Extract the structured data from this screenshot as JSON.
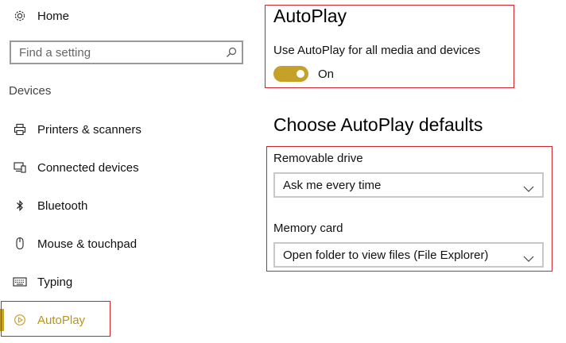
{
  "nav": {
    "home_label": "Home",
    "search_placeholder": "Find a setting",
    "section_title": "Devices",
    "items": [
      {
        "label": "Printers & scanners",
        "icon": "printer-icon",
        "selected": false
      },
      {
        "label": "Connected devices",
        "icon": "connected-devices-icon",
        "selected": false
      },
      {
        "label": "Bluetooth",
        "icon": "bluetooth-icon",
        "selected": false
      },
      {
        "label": "Mouse & touchpad",
        "icon": "mouse-icon",
        "selected": false
      },
      {
        "label": "Typing",
        "icon": "keyboard-icon",
        "selected": false
      },
      {
        "label": "AutoPlay",
        "icon": "autoplay-icon",
        "selected": true
      }
    ]
  },
  "main": {
    "autoplay_title": "AutoPlay",
    "use_autoplay_label": "Use AutoPlay for all media and devices",
    "toggle_state": "On",
    "defaults_title": "Choose AutoPlay defaults",
    "removable_drive_label": "Removable drive",
    "removable_drive_value": "Ask me every time",
    "memory_card_label": "Memory card",
    "memory_card_value": "Open folder to view files (File Explorer)"
  },
  "colors": {
    "accent": "#c5a12a",
    "selected_text": "#b8941f",
    "highlight_box": "#d1252e"
  }
}
